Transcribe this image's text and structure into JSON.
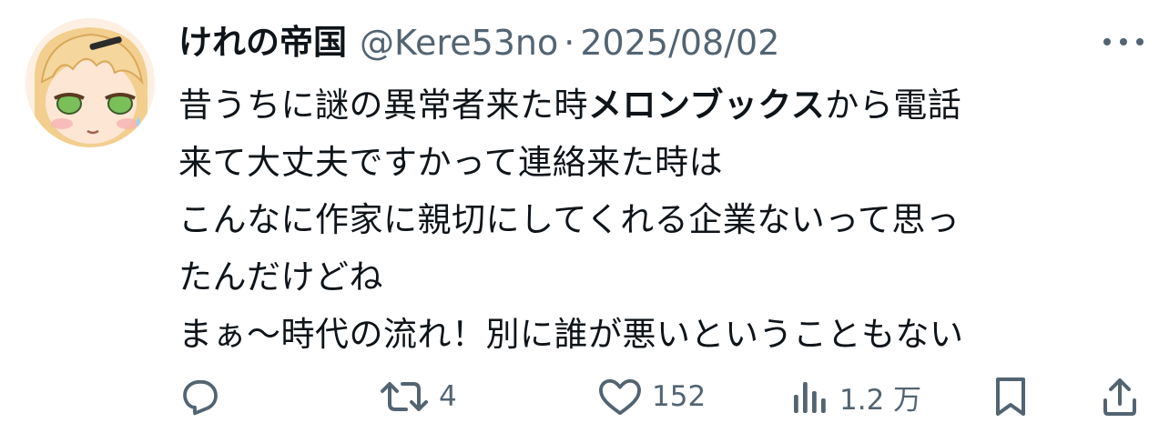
{
  "tweet": {
    "author": {
      "display_name": "けれの帝国",
      "handle": "@Kere53no",
      "separator": "·",
      "date": "2025/08/02"
    },
    "body": {
      "line1_a": "昔うちに謎の異常者来た時",
      "line1_bold": "メロンブックス",
      "line1_b": "から電話",
      "line2": "来て大丈夫ですかって連絡来た時は",
      "line3": "こんなに作家に親切にしてくれる企業ないって思っ",
      "line4": "たんだけどね",
      "line5": "まぁ〜時代の流れ！別に誰が悪いということもない"
    },
    "actions": {
      "reply_icon": "reply-icon",
      "retweet_icon": "retweet-icon",
      "retweet_count": "4",
      "like_icon": "heart-icon",
      "like_count": "152",
      "views_icon": "views-icon",
      "views_count": "1.2 万",
      "bookmark_icon": "bookmark-icon",
      "share_icon": "share-icon"
    }
  },
  "colors": {
    "text_primary": "#0f1419",
    "text_secondary": "#536471",
    "background": "#ffffff"
  }
}
